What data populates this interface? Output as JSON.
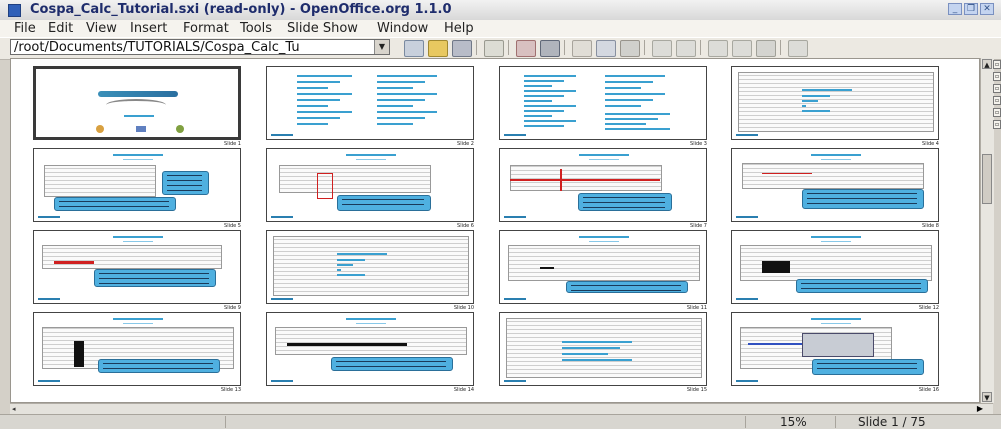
{
  "window": {
    "title": "Cospa_Calc_Tutorial.sxi (read-only) - OpenOffice.org 1.1.0",
    "controls": [
      "minimize-icon",
      "restore-icon",
      "close-icon"
    ]
  },
  "menubar": {
    "items": [
      "File",
      "Edit",
      "View",
      "Insert",
      "Format",
      "Tools",
      "Slide Show",
      "Window",
      "Help"
    ]
  },
  "toolbar": {
    "url": "/root/Documents/TUTORIALS/Cospa_Calc_Tu",
    "icons": [
      "edit-file-icon",
      "open-icon",
      "save-icon",
      "email-icon",
      "export-pdf-icon",
      "print-icon",
      "cut-icon",
      "copy-icon",
      "paste-icon",
      "undo-icon",
      "redo-icon",
      "navigator-icon",
      "stylist-icon",
      "gallery-icon",
      "zoom-icon"
    ]
  },
  "slides": [
    {
      "label": "Slide 1",
      "template": "logo"
    },
    {
      "label": "Slide 2",
      "template": "toc"
    },
    {
      "label": "Slide 3",
      "template": "toc2"
    },
    {
      "label": "Slide 4",
      "template": "screen-list"
    },
    {
      "label": "Slide 5",
      "template": "calc-callout-right"
    },
    {
      "label": "Slide 6",
      "template": "calc-red-box"
    },
    {
      "label": "Slide 7",
      "template": "calc-red-line"
    },
    {
      "label": "Slide 8",
      "template": "calc-callout-right2"
    },
    {
      "label": "Slide 9",
      "template": "calc-red-arrow"
    },
    {
      "label": "Slide 10",
      "template": "screen-list"
    },
    {
      "label": "Slide 11",
      "template": "calc-callout-bottom"
    },
    {
      "label": "Slide 12",
      "template": "calc-black-rect"
    },
    {
      "label": "Slide 13",
      "template": "calc-black-col"
    },
    {
      "label": "Slide 14",
      "template": "calc-black-row"
    },
    {
      "label": "Slide 15",
      "template": "screen-list2"
    },
    {
      "label": "Slide 16",
      "template": "calc-dialog"
    }
  ],
  "status": {
    "zoom": "15%",
    "slide": "Slide 1 / 75"
  },
  "colors": {
    "accent": "#2a8fc0",
    "callout": "#4fb0e0",
    "red": "#d02020"
  }
}
